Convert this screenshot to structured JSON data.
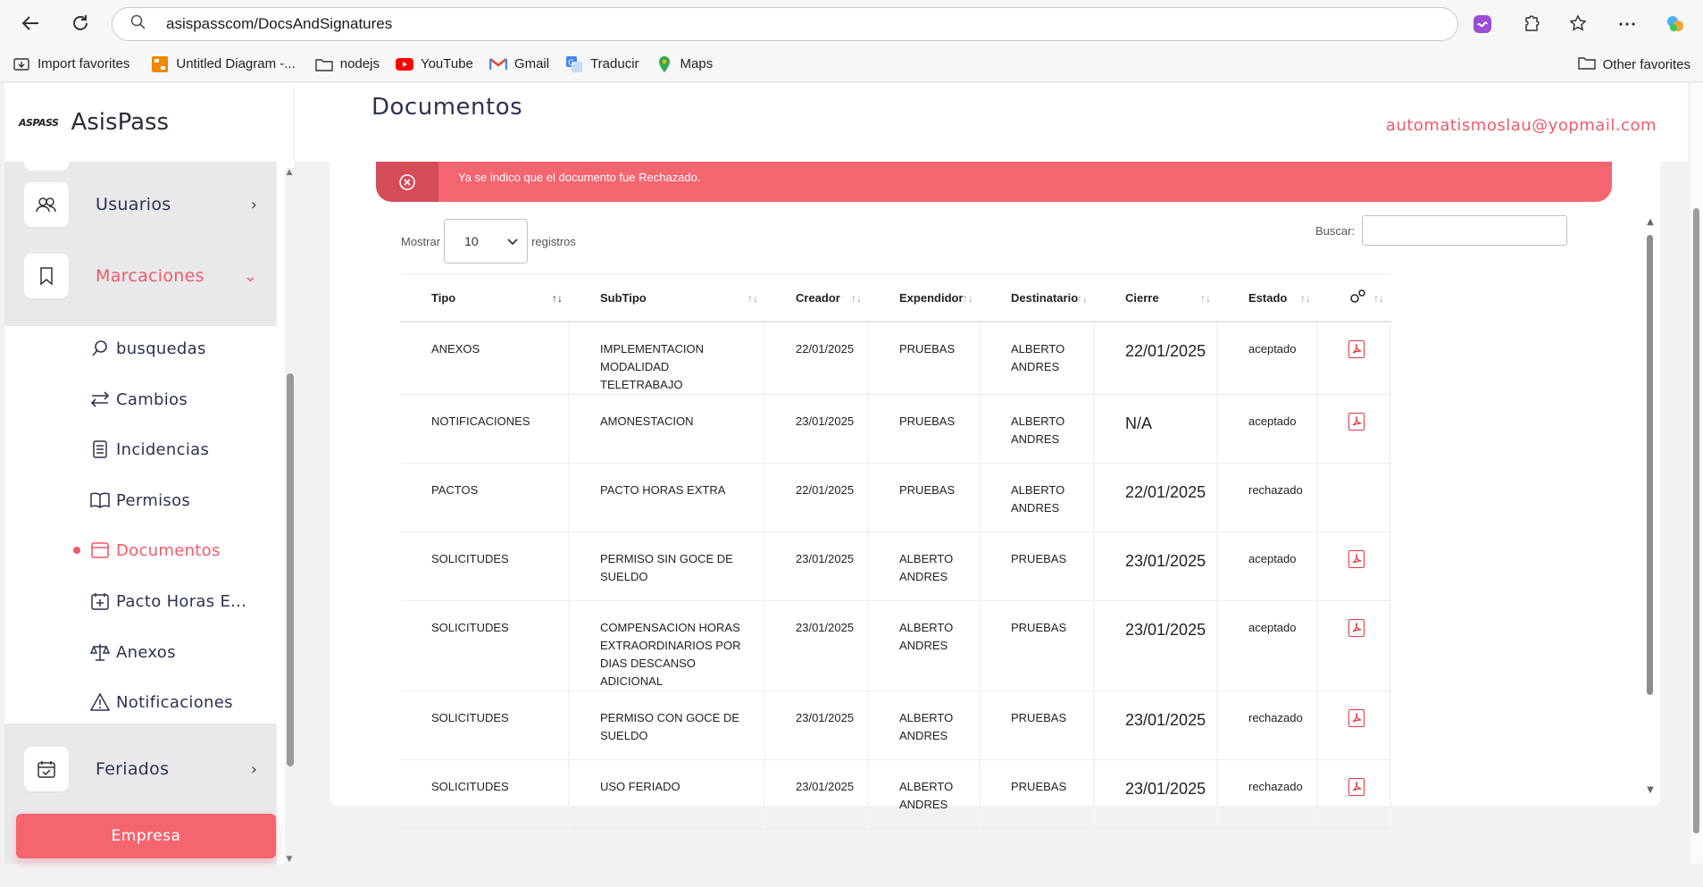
{
  "browser": {
    "url": "asispasscom/DocsAndSignatures",
    "bookmarks": [
      {
        "label": "Import favorites",
        "icon": "import-icon"
      },
      {
        "label": "Untitled Diagram -...",
        "icon": "drawio-icon"
      },
      {
        "label": "nodejs",
        "icon": "folder-icon"
      },
      {
        "label": "YouTube",
        "icon": "youtube-icon"
      },
      {
        "label": "Gmail",
        "icon": "gmail-icon"
      },
      {
        "label": "Traducir",
        "icon": "translate-icon"
      },
      {
        "label": "Maps",
        "icon": "maps-icon"
      }
    ],
    "other_favorites": "Other favorites"
  },
  "brand": {
    "logo": "ASPASS",
    "name": "AsisPass"
  },
  "menu": {
    "usuarios": "Usuarios",
    "marcaciones": "Marcaciones",
    "feriados": "Feriados",
    "submenu": [
      {
        "label": "busquedas",
        "icon": "search-icon"
      },
      {
        "label": "Cambios",
        "icon": "swap-icon"
      },
      {
        "label": "Incidencias",
        "icon": "list-icon"
      },
      {
        "label": "Permisos",
        "icon": "book-icon"
      },
      {
        "label": "Documentos",
        "icon": "document-icon"
      },
      {
        "label": "Pacto Horas E...",
        "icon": "calendar-plus-icon"
      },
      {
        "label": "Anexos",
        "icon": "scale-icon"
      },
      {
        "label": "Notificaciones",
        "icon": "warning-icon"
      }
    ],
    "empresa": "Empresa"
  },
  "header": {
    "title": "Documentos",
    "email": "automatismoslau@yopmail.com"
  },
  "alert": {
    "message": "Ya se indico que el documento fue Rechazado."
  },
  "controls": {
    "show_label": "Mostrar",
    "show_value": "10",
    "records_label": "registros",
    "search_label": "Buscar:"
  },
  "colors": {
    "accent": "#f05a6a",
    "alert_bg": "#f5656f"
  },
  "table": {
    "headers": [
      "Tipo",
      "SubTipo",
      "Creador",
      "Expendidor",
      "Destinatario",
      "Cierre",
      "Estado"
    ],
    "rows": [
      {
        "tipo": "ANEXOS",
        "subtipo": "IMPLEMENTACION MODALIDAD TELETRABAJO",
        "creador": "22/01/2025",
        "expendidor": "PRUEBAS",
        "destinatario": "ALBERTO ANDRES",
        "cierre": "22/01/2025",
        "estado": "aceptado",
        "pdf": true
      },
      {
        "tipo": "NOTIFICACIONES",
        "subtipo": "AMONESTACION",
        "creador": "23/01/2025",
        "expendidor": "PRUEBAS",
        "destinatario": "ALBERTO ANDRES",
        "cierre": "N/A",
        "estado": "aceptado",
        "pdf": true
      },
      {
        "tipo": "PACTOS",
        "subtipo": "PACTO HORAS EXTRA",
        "creador": "22/01/2025",
        "expendidor": "PRUEBAS",
        "destinatario": "ALBERTO ANDRES",
        "cierre": "22/01/2025",
        "estado": "rechazado",
        "pdf": false
      },
      {
        "tipo": "SOLICITUDES",
        "subtipo": "PERMISO SIN GOCE DE SUELDO",
        "creador": "23/01/2025",
        "expendidor": "ALBERTO ANDRES",
        "destinatario": "PRUEBAS",
        "cierre": "23/01/2025",
        "estado": "aceptado",
        "pdf": true
      },
      {
        "tipo": "SOLICITUDES",
        "subtipo": "COMPENSACION HORAS EXTRAORDINARIOS POR DIAS DESCANSO ADICIONAL",
        "creador": "23/01/2025",
        "expendidor": "ALBERTO ANDRES",
        "destinatario": "PRUEBAS",
        "cierre": "23/01/2025",
        "estado": "aceptado",
        "pdf": true
      },
      {
        "tipo": "SOLICITUDES",
        "subtipo": "PERMISO CON GOCE DE SUELDO",
        "creador": "23/01/2025",
        "expendidor": "ALBERTO ANDRES",
        "destinatario": "PRUEBAS",
        "cierre": "23/01/2025",
        "estado": "rechazado",
        "pdf": true
      },
      {
        "tipo": "SOLICITUDES",
        "subtipo": "USO FERIADO",
        "creador": "23/01/2025",
        "expendidor": "ALBERTO ANDRES",
        "destinatario": "PRUEBAS",
        "cierre": "23/01/2025",
        "estado": "rechazado",
        "pdf": true
      }
    ]
  }
}
